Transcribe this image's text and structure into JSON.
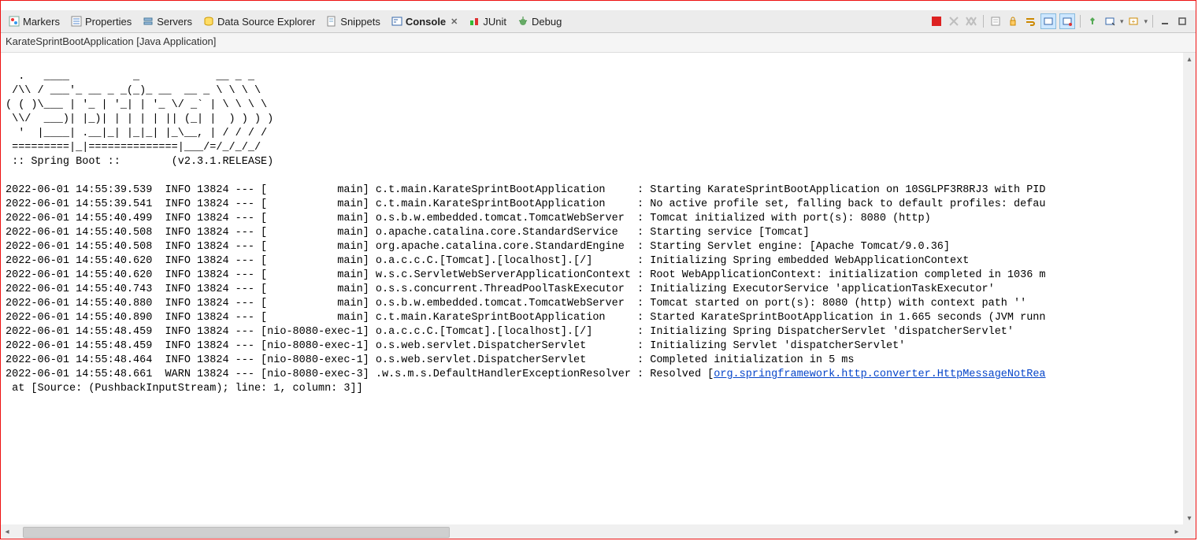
{
  "tabs": {
    "markers": {
      "label": "Markers"
    },
    "properties": {
      "label": "Properties"
    },
    "servers": {
      "label": "Servers"
    },
    "dse": {
      "label": "Data Source Explorer"
    },
    "snippets": {
      "label": "Snippets"
    },
    "console": {
      "label": "Console"
    },
    "junit": {
      "label": "JUnit"
    },
    "debug": {
      "label": "Debug"
    }
  },
  "subtitle": "KarateSprintBootApplication [Java Application]",
  "springBanner": "  .   ____          _            __ _ _\n /\\\\ / ___'_ __ _ _(_)_ __  __ _ \\ \\ \\ \\\n( ( )\\___ | '_ | '_| | '_ \\/ _` | \\ \\ \\ \\\n \\\\/  ___)| |_)| | | | | || (_| |  ) ) ) )\n  '  |____| .__|_| |_|_| |_\\__, | / / / /\n =========|_|==============|___/=/_/_/_/\n :: Spring Boot ::        (v2.3.1.RELEASE)",
  "logLines": [
    "2022-06-01 14:55:39.539  INFO 13824 --- [           main] c.t.main.KarateSprintBootApplication     : Starting KarateSprintBootApplication on 10SGLPF3R8RJ3 with PID",
    "2022-06-01 14:55:39.541  INFO 13824 --- [           main] c.t.main.KarateSprintBootApplication     : No active profile set, falling back to default profiles: defau",
    "2022-06-01 14:55:40.499  INFO 13824 --- [           main] o.s.b.w.embedded.tomcat.TomcatWebServer  : Tomcat initialized with port(s): 8080 (http)",
    "2022-06-01 14:55:40.508  INFO 13824 --- [           main] o.apache.catalina.core.StandardService   : Starting service [Tomcat]",
    "2022-06-01 14:55:40.508  INFO 13824 --- [           main] org.apache.catalina.core.StandardEngine  : Starting Servlet engine: [Apache Tomcat/9.0.36]",
    "2022-06-01 14:55:40.620  INFO 13824 --- [           main] o.a.c.c.C.[Tomcat].[localhost].[/]       : Initializing Spring embedded WebApplicationContext",
    "2022-06-01 14:55:40.620  INFO 13824 --- [           main] w.s.c.ServletWebServerApplicationContext : Root WebApplicationContext: initialization completed in 1036 m",
    "2022-06-01 14:55:40.743  INFO 13824 --- [           main] o.s.s.concurrent.ThreadPoolTaskExecutor  : Initializing ExecutorService 'applicationTaskExecutor'",
    "2022-06-01 14:55:40.880  INFO 13824 --- [           main] o.s.b.w.embedded.tomcat.TomcatWebServer  : Tomcat started on port(s): 8080 (http) with context path ''",
    "2022-06-01 14:55:40.890  INFO 13824 --- [           main] c.t.main.KarateSprintBootApplication     : Started KarateSprintBootApplication in 1.665 seconds (JVM runn",
    "2022-06-01 14:55:48.459  INFO 13824 --- [nio-8080-exec-1] o.a.c.c.C.[Tomcat].[localhost].[/]       : Initializing Spring DispatcherServlet 'dispatcherServlet'",
    "2022-06-01 14:55:48.459  INFO 13824 --- [nio-8080-exec-1] o.s.web.servlet.DispatcherServlet        : Initializing Servlet 'dispatcherServlet'",
    "2022-06-01 14:55:48.464  INFO 13824 --- [nio-8080-exec-1] o.s.web.servlet.DispatcherServlet        : Completed initialization in 5 ms"
  ],
  "warnLine": {
    "prefix": "2022-06-01 14:55:48.661  WARN 13824 --- [nio-8080-exec-3] .w.s.m.s.DefaultHandlerExceptionResolver : Resolved [",
    "link": "org.springframework.http.converter.HttpMessageNotRea"
  },
  "traceLine": " at [Source: (PushbackInputStream); line: 1, column: 3]]"
}
